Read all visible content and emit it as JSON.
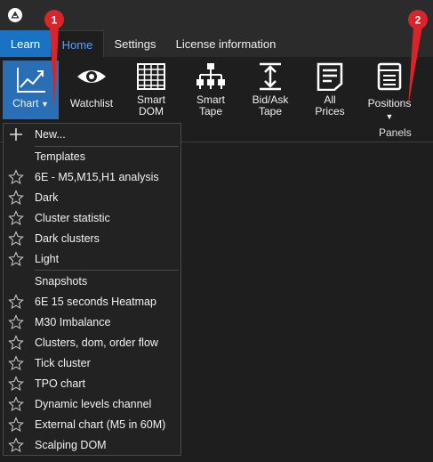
{
  "titlebar": {
    "logo_icon": "app-logo-icon"
  },
  "tabs": {
    "learn": "Learn",
    "home": "Home",
    "settings": "Settings",
    "license": "License information"
  },
  "ribbon": {
    "chart": "Chart",
    "watchlist": "Watchlist",
    "smart_dom_1": "Smart",
    "smart_dom_2": "DOM",
    "smart_tape_1": "Smart",
    "smart_tape_2": "Tape",
    "bidask_1": "Bid/Ask",
    "bidask_2": "Tape",
    "allprices_1": "All",
    "allprices_2": "Prices",
    "positions": "Positions",
    "panels_group": "Panels"
  },
  "callouts": {
    "one": "1",
    "two": "2",
    "color": "#d9252a"
  },
  "menu": {
    "new": "New...",
    "templates_header": "Templates",
    "templates": [
      "6E - M5,M15,H1 analysis",
      "Dark",
      "Cluster statistic",
      "Dark clusters",
      "Light"
    ],
    "snapshots_header": "Snapshots",
    "snapshots": [
      "6E 15 seconds Heatmap",
      "M30 Imbalance",
      "Clusters, dom, order flow",
      "Tick cluster",
      "TPO chart",
      "Dynamic levels channel",
      "External chart (M5 in 60M)",
      "Scalping DOM"
    ]
  },
  "colors": {
    "accent": "#1a73c2",
    "active_tab_text": "#4aa3ff",
    "background": "#1e1e1e"
  }
}
